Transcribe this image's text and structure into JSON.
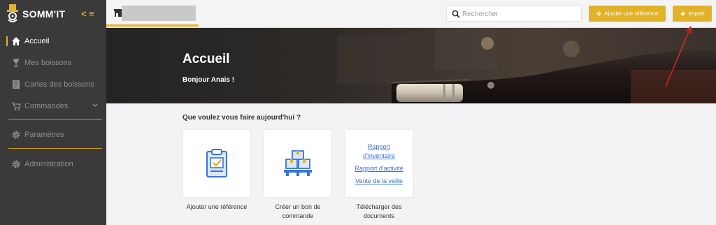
{
  "app": {
    "name": "SOMM'IT",
    "collapse_label": "< ≡"
  },
  "sidebar": {
    "items": [
      {
        "id": "accueil",
        "label": "Accueil",
        "icon": "home-icon",
        "active": true
      },
      {
        "id": "mes-boissons",
        "label": "Mes boissons",
        "icon": "wine-glass-icon"
      },
      {
        "id": "cartes",
        "label": "Cartes des boissons",
        "icon": "menu-card-icon"
      },
      {
        "id": "commandes",
        "label": "Commandes",
        "icon": "cart-icon",
        "has_submenu": true
      },
      {
        "id": "parametres",
        "label": "Paramètres",
        "icon": "gear-icon"
      },
      {
        "id": "administration",
        "label": "Administration",
        "icon": "gear-icon"
      }
    ]
  },
  "topbar": {
    "store_name": "",
    "store_icon": "store-icon",
    "search_placeholder": "Rechercher",
    "search_value": "",
    "add_reference_label": "Ajouter une référence",
    "import_label": "Import",
    "plus": "+"
  },
  "hero": {
    "title": "Accueil",
    "greeting": "Bonjour Anais !"
  },
  "main": {
    "question": "Que voulez vous faire aujourd'hui ?",
    "cards": [
      {
        "caption": "Ajouter une référence",
        "icon": "clipboard-check-icon"
      },
      {
        "caption": "Créer un bon de commande",
        "icon": "boxes-pallet-icon"
      },
      {
        "caption": "Télécharger des documents",
        "links": [
          "Rapport d'inventaire",
          "Rapport d'activité",
          "Vente de la veille"
        ]
      }
    ]
  },
  "colors": {
    "accent": "#e2b22a",
    "sidebar_bg": "#3a3a3a",
    "link": "#3b74d9",
    "annotation_arrow": "#d42a2a"
  }
}
